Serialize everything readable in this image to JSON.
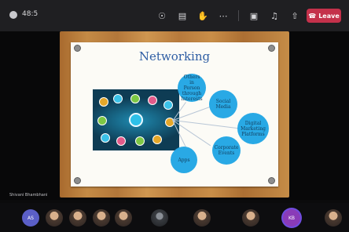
{
  "meeting": {
    "elapsed": "48:5",
    "leave_label": "Leave",
    "toolbar_icons": [
      "people-icon",
      "chat-icon",
      "reactions-icon",
      "more-icon",
      "camera-icon",
      "mic-icon",
      "share-icon"
    ]
  },
  "slide": {
    "title": "Networking",
    "bubbles": [
      "Others in Person through Interests",
      "Social Media",
      "Digital Marketing Platforms",
      "Corporate Events",
      "Apps"
    ]
  },
  "presenter": {
    "name": "Shivani Bhambhani"
  },
  "participants": [
    {
      "kind": "initials",
      "text": "AS",
      "color": "#5b5fc7"
    },
    {
      "kind": "photo"
    },
    {
      "kind": "photo"
    },
    {
      "kind": "photo"
    },
    {
      "kind": "photo"
    },
    {
      "kind": "dark"
    },
    {
      "kind": "photo"
    },
    {
      "kind": "photo"
    },
    {
      "kind": "initials",
      "text": "KB",
      "color": "#8a3bb8",
      "active": true
    },
    {
      "kind": "photo"
    }
  ],
  "colors": {
    "leave": "#c4314b",
    "bubble": "#29a9e5",
    "title": "#2f5ea4"
  }
}
